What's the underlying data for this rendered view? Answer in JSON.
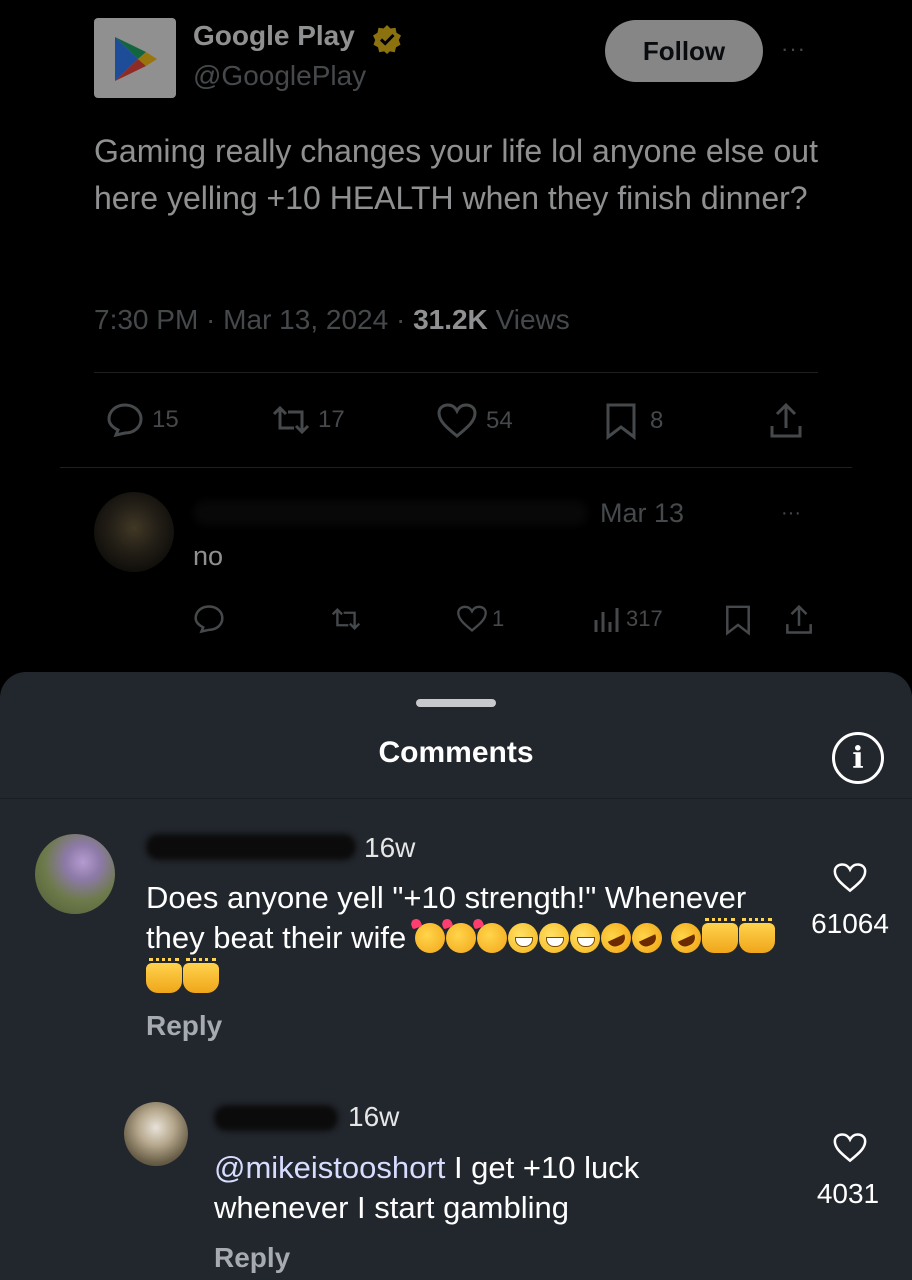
{
  "tweet": {
    "account_name": "Google Play",
    "handle": "@GooglePlay",
    "follow_label": "Follow",
    "more_label": "···",
    "text": "Gaming really changes your life lol anyone else out here yelling +10 HEALTH when they finish dinner?",
    "time": "7:30 PM",
    "date": "Mar 13, 2024",
    "views_count": "31.2K",
    "views_label": "Views",
    "actions": {
      "replies": "15",
      "reposts": "17",
      "likes": "54",
      "bookmarks": "8"
    }
  },
  "reply": {
    "date": "Mar 13",
    "more_label": "···",
    "text": "no",
    "likes": "1",
    "views": "317"
  },
  "comments_sheet": {
    "title": "Comments",
    "info_label": "i",
    "comments": [
      {
        "time": "16w",
        "text": "Does anyone yell \"+10 strength!\" Whenever they beat their wife",
        "reply_label": "Reply",
        "likes": "61064"
      },
      {
        "time": "16w",
        "mention": "@mikeistooshort",
        "text": " I get +10 luck whenever I start gambling",
        "reply_label": "Reply",
        "likes": "4031"
      }
    ]
  },
  "colors": {
    "background": "#000000",
    "sheet": "#22262d",
    "muted": "#71767b",
    "follow_button": "#d9d9d9"
  }
}
